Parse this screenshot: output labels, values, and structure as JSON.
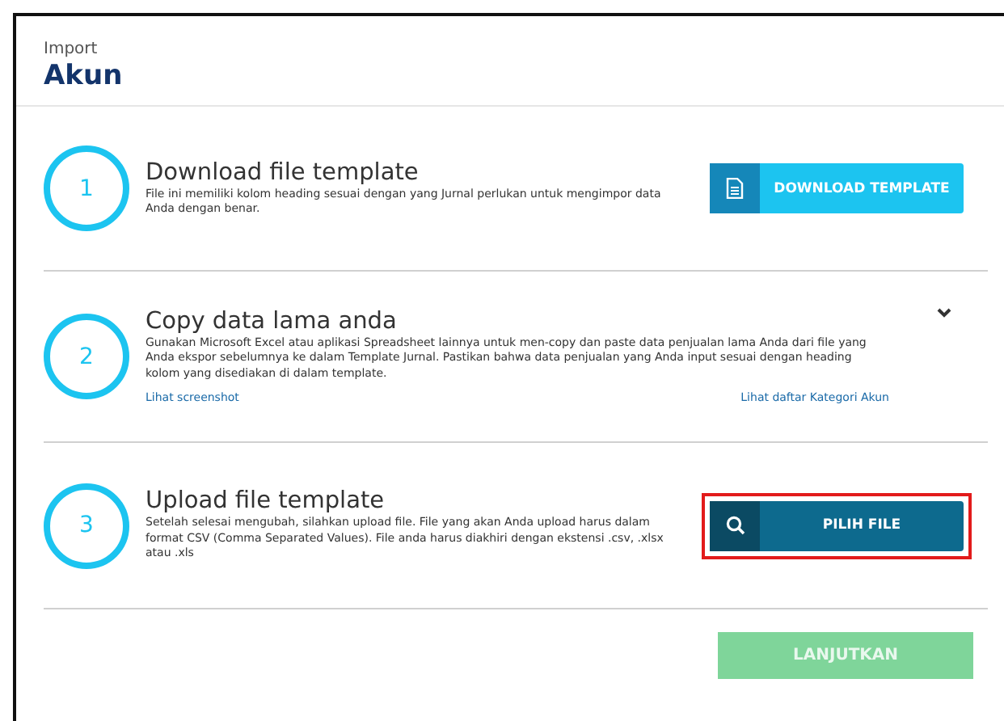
{
  "header": {
    "subtitle": "Import",
    "title": "Akun"
  },
  "steps": [
    {
      "number": "1",
      "kind": "download",
      "title": "Download file template",
      "description": "File ini memiliki kolom heading sesuai dengan yang Jurnal perlukan untuk mengimpor data Anda dengan benar.",
      "button": {
        "label": "DOWNLOAD TEMPLATE",
        "highlighted": false
      }
    },
    {
      "number": "2",
      "kind": "info",
      "title": "Copy data lama anda",
      "description": "Gunakan Microsoft Excel atau aplikasi Spreadsheet lainnya untuk men-copy dan paste data penjualan lama Anda dari file yang Anda ekspor sebelumnya ke dalam Template Jurnal. Pastikan bahwa data penjualan yang Anda input sesuai dengan heading kolom yang disediakan di dalam template.",
      "expanded": false,
      "links": [
        "Lihat screenshot",
        "Lihat daftar Kategori Akun"
      ]
    },
    {
      "number": "3",
      "kind": "upload",
      "title": "Upload file template",
      "description": "Setelah selesai mengubah, silahkan upload file. File yang akan Anda upload harus dalam format CSV (Comma Separated Values). File anda harus diakhiri dengan ekstensi .csv, .xlsx atau .xls",
      "button": {
        "label": "PILIH FILE",
        "highlighted": true
      }
    }
  ],
  "continue_button": {
    "label": "LANJUTKAN",
    "disabled": true
  }
}
